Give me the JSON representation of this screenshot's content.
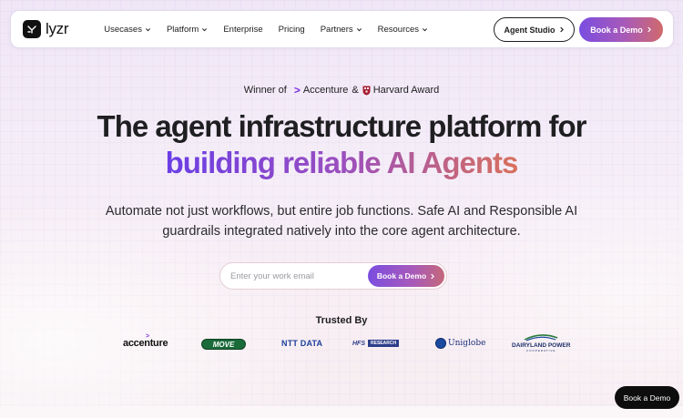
{
  "nav": {
    "logo_text": "lyzr",
    "menu": [
      {
        "label": "Usecases",
        "has_dropdown": true
      },
      {
        "label": "Platform",
        "has_dropdown": true
      },
      {
        "label": "Enterprise",
        "has_dropdown": false
      },
      {
        "label": "Pricing",
        "has_dropdown": false
      },
      {
        "label": "Partners",
        "has_dropdown": true
      },
      {
        "label": "Resources",
        "has_dropdown": true
      }
    ],
    "agent_studio_label": "Agent Studio",
    "book_demo_label": "Book a Demo"
  },
  "hero": {
    "winner_prefix": "Winner of",
    "winner_partner": "Accenture",
    "winner_amp": "&",
    "winner_award": "Harvard Award",
    "headline_line1": "The agent infrastructure platform for",
    "headline_line2": "building reliable AI Agents",
    "subheadline": "Automate not just workflows, but entire job functions. Safe AI and Responsible AI guardrails integrated natively into the core agent architecture.",
    "email_placeholder": "Enter your work email",
    "cta_label": "Book a Demo"
  },
  "trusted": {
    "heading": "Trusted By",
    "logos": [
      {
        "name": "accenture",
        "text": "accenture"
      },
      {
        "name": "move",
        "text": "MOVE"
      },
      {
        "name": "ntt-data",
        "text": "NTT DATA"
      },
      {
        "name": "hfs-research",
        "text": "HFS",
        "tag": "RESEARCH"
      },
      {
        "name": "uniglobe",
        "text": "Uniglobe"
      },
      {
        "name": "dairyland-power",
        "text": "DAIRYLAND POWER",
        "sub": "COOPERATIVE"
      }
    ]
  },
  "floating": {
    "book_demo_label": "Book a Demo"
  },
  "colors": {
    "accent_purple": "#7a4de0",
    "accent_coral": "#d06a6c",
    "dark": "#1d1d1f"
  },
  "icons": {
    "logo": "lyzr-mark-icon",
    "dropdown": "chevron-down-icon",
    "arrow": "chevron-right-icon",
    "crest": "harvard-crest-icon"
  }
}
